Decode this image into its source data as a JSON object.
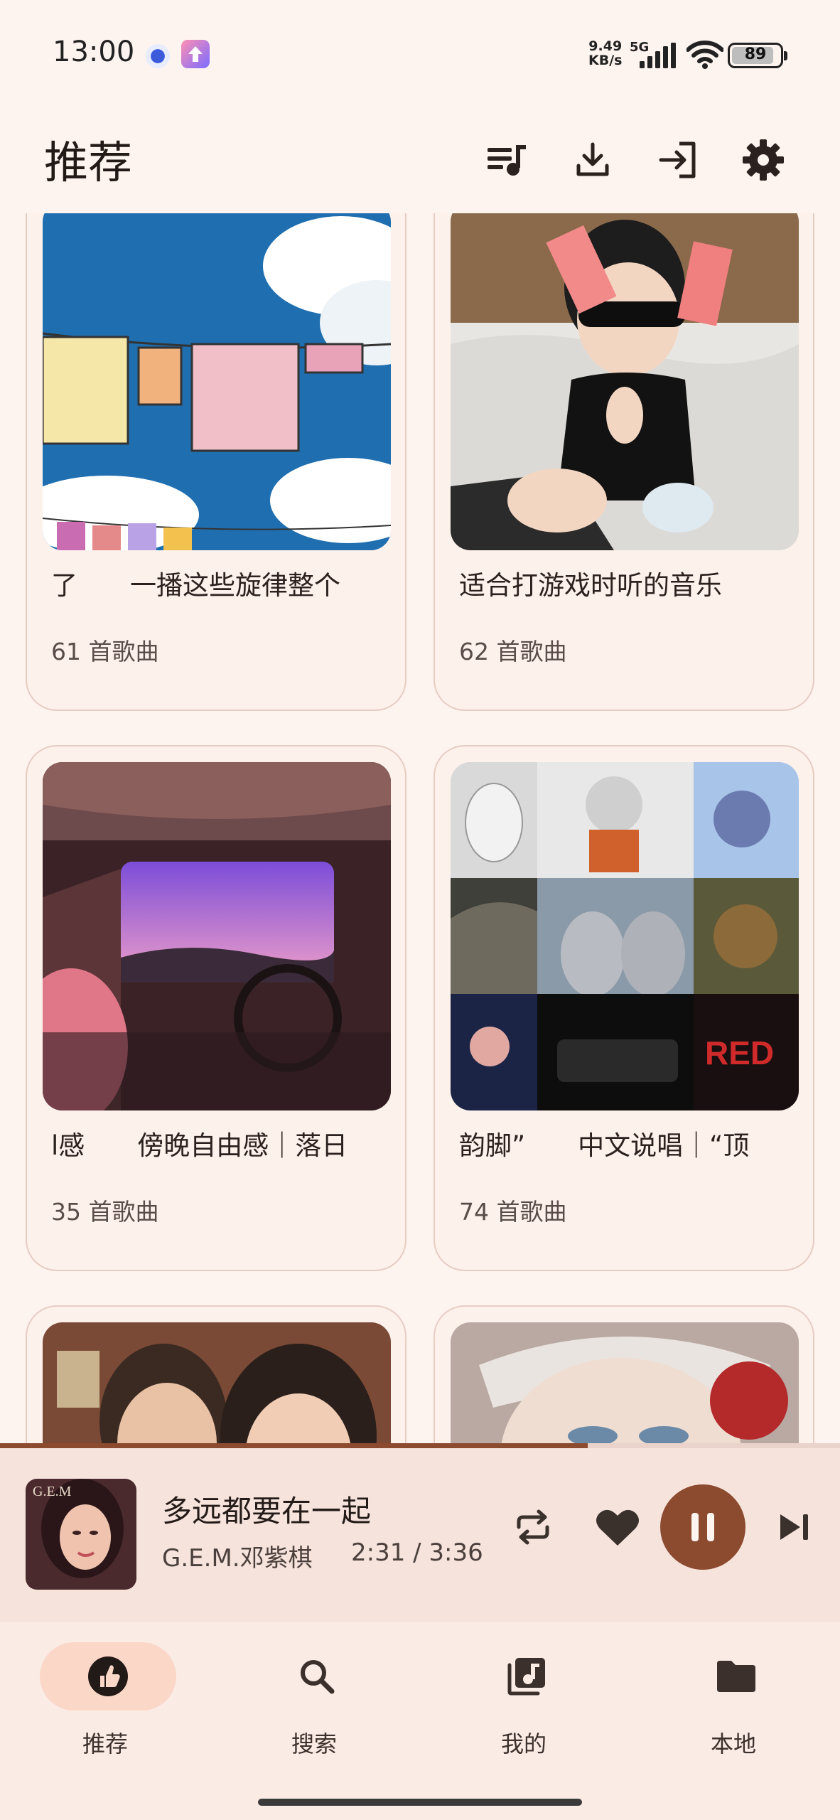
{
  "status_bar": {
    "time": "13:00",
    "network_speed_value": "9.49",
    "network_speed_unit": "KB/s",
    "network_type": "5G",
    "battery_level": "89",
    "icons": [
      "notification-dot-icon",
      "app-update-icon",
      "signal-icon",
      "wifi-icon",
      "battery-icon"
    ]
  },
  "header": {
    "title": "推荐",
    "actions": [
      "playlist-queue-icon",
      "download-icon",
      "login-icon",
      "settings-icon"
    ]
  },
  "playlists": [
    {
      "title": "了　　一播这些旋律整个",
      "count": "61 首歌曲"
    },
    {
      "title": "适合打游戏时听的音乐",
      "count": "62 首歌曲"
    },
    {
      "title": "l感　　傍晚自由感｜落日",
      "count": "35 首歌曲"
    },
    {
      "title": "韵脚”　　中文说唱｜“顶",
      "count": "74 首歌曲"
    },
    {
      "title": "",
      "count": ""
    },
    {
      "title": "",
      "count": ""
    }
  ],
  "player": {
    "title": "多远都要在一起",
    "artist": "G.E.M.邓紫棋",
    "time": "2:31 / 3:36",
    "progress": 0.7,
    "liked": true,
    "state": "playing"
  },
  "nav": {
    "items": [
      {
        "label": "推荐",
        "icon": "thumb-up-icon",
        "active": true
      },
      {
        "label": "搜索",
        "icon": "search-icon",
        "active": false
      },
      {
        "label": "我的",
        "icon": "music-library-icon",
        "active": false
      },
      {
        "label": "本地",
        "icon": "folder-icon",
        "active": false
      }
    ]
  },
  "colors": {
    "background": "#fdf3ef",
    "accent": "#8c4a2f",
    "nav_active_pill": "#fbd7c8",
    "card_border": "#e6ccc3"
  }
}
